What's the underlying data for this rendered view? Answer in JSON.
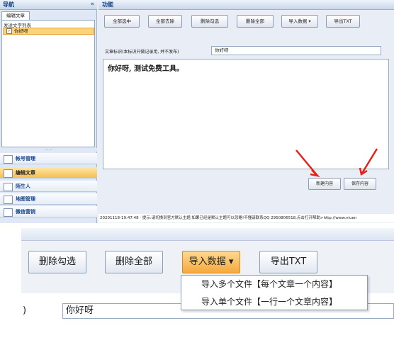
{
  "nav": {
    "title": "导航",
    "collapse": "«",
    "tab": "编辑文章",
    "list_title": "发送文字列表",
    "list_item": "你好呀"
  },
  "splitter": "......",
  "menu": [
    "帐号管理",
    "编辑文章",
    "陌生人",
    "地图管理",
    "微信营销"
  ],
  "func": {
    "title": "功能",
    "toolbar": [
      "全部选中",
      "全部去除",
      "删除勾选",
      "删除全部",
      "导入数据",
      "导出TXT"
    ],
    "mark_label": "文章标识(本标识只做记录用, 并不发布)",
    "mark_value": "你好呀",
    "editor_text": "你好呀, 测试免费工具。",
    "new_btn": "新建内容",
    "save_btn": "保存内容"
  },
  "status": "20201118-19:47:48 · 提示:请切换到官方默认主题.如果已经是默认主题可以忽略!不懂请联系QQ 2950806518,点击打开帮助>http://www.niuen",
  "zoom": {
    "buttons": [
      "删除勾选",
      "删除全部",
      "导入数据",
      "导出TXT"
    ],
    "dropdown_arrow": "▾",
    "menu_items": [
      "导入多个文件【每个文章一个内容】",
      "导入单个文件【一行一个文章内容】"
    ],
    "field_prefix": ")",
    "field_value": "你好呀"
  },
  "colors": {
    "accent": "#f6a93c",
    "selection": "#fbd37a",
    "arrow": "#e2231a"
  }
}
